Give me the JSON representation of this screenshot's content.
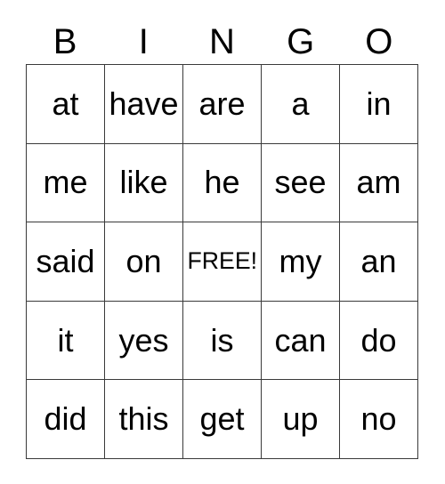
{
  "card": {
    "headers": [
      "B",
      "I",
      "N",
      "G",
      "O"
    ],
    "rows": [
      [
        "at",
        "have",
        "are",
        "a",
        "in"
      ],
      [
        "me",
        "like",
        "he",
        "see",
        "am"
      ],
      [
        "said",
        "on",
        "FREE!",
        "my",
        "an"
      ],
      [
        "it",
        "yes",
        "is",
        "can",
        "do"
      ],
      [
        "did",
        "this",
        "get",
        "up",
        "no"
      ]
    ],
    "free_space": "FREE!",
    "colors": {
      "grid_line": "#3a3a3a",
      "text": "#000000",
      "background": "#ffffff"
    }
  }
}
